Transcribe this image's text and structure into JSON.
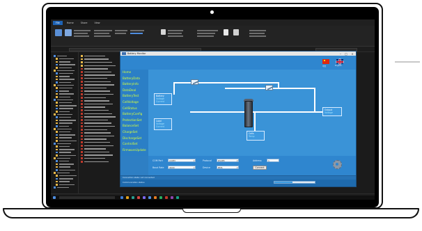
{
  "explorer": {
    "ribbon_tabs": [
      "File",
      "Home",
      "Share",
      "View"
    ],
    "active_tab": "Home"
  },
  "app": {
    "title": "Battery Monitor",
    "menu": [
      "Home",
      "BatteryData",
      "BatteryInfo",
      "DataDeal",
      "BatteryTest",
      "CellVoltage",
      "CellStatus",
      "BatteryConfig",
      "ProtectionSet",
      "BalanceSet",
      "ChargeSet",
      "DischargeSet",
      "ControlSet",
      "FirmwareUpdate"
    ],
    "language": {
      "cn_label": "中文",
      "en_label": "English"
    },
    "diagram": {
      "battery_box": {
        "title": "Battery",
        "lines": [
          "Voltage",
          "Current",
          "SOC"
        ]
      },
      "load_box": {
        "title": "Load",
        "lines": [
          "Voltage",
          "Current"
        ]
      },
      "output_box": {
        "title": "Output",
        "lines": [
          "Voltage",
          "Current"
        ]
      },
      "cell_box": {
        "title": "Cells",
        "lines": [
          "Temp",
          "Status"
        ]
      }
    },
    "controls": {
      "port_label": "COM Port",
      "port_value": "COM3",
      "baud_label": "Baud Rate",
      "baud_value": "9600",
      "protocol_label": "Protocol",
      "protocol_value": "RS485",
      "address_label": "Address",
      "address_value": "1",
      "device_label": "Device",
      "device_value": "BMS",
      "connect_label": "Connect"
    },
    "status_line_1": "Connection state: not connected",
    "status_line_2": "Communication status",
    "progress": 0.45
  },
  "colors": {
    "app_bg": "#2e7fc4",
    "menu_text": "#d8ff3a",
    "pipe": "#ffffff"
  }
}
